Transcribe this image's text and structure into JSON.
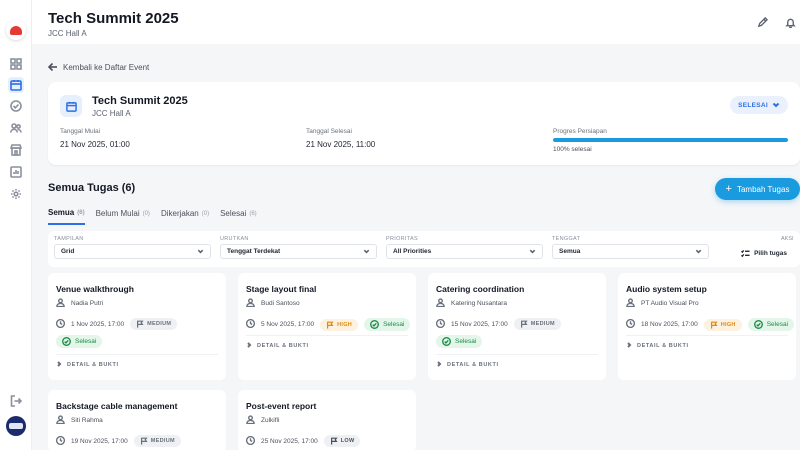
{
  "header": {
    "title": "Tech Summit 2025",
    "subtitle": "JCC Hall A"
  },
  "back_link": "Kembali ke Daftar Event",
  "event": {
    "title": "Tech Summit 2025",
    "location": "JCC Hall A",
    "status": "SELESAI",
    "start_label": "Tanggal Mulai",
    "start_value": "21 Nov 2025, 01:00",
    "end_label": "Tanggal Selesai",
    "end_value": "21 Nov 2025, 11:00",
    "progress_label": "Progres Persiapan",
    "progress_text": "100% selesai",
    "progress_value": 100
  },
  "section": {
    "title": "Semua Tugas (6)",
    "add_label": "Tambah Tugas"
  },
  "tabs": [
    {
      "label": "Semua",
      "count": "(6)"
    },
    {
      "label": "Belum Mulai",
      "count": "(0)"
    },
    {
      "label": "Dikerjakan",
      "count": "(0)"
    },
    {
      "label": "Selesai",
      "count": "(6)"
    }
  ],
  "filters": {
    "view": {
      "label": "TAMPILAN",
      "value": "Grid"
    },
    "sort": {
      "label": "URUTKAN",
      "value": "Tenggat Terdekat"
    },
    "priority": {
      "label": "PRIORITAS",
      "value": "All Priorities"
    },
    "deadline": {
      "label": "TENGGAT",
      "value": "Semua"
    },
    "action_label": "AKSI",
    "select_label": "Pilih tugas"
  },
  "detail_label": "DETAIL & BUKTI",
  "done_label": "Selesai",
  "tasks": [
    {
      "title": "Venue walkthrough",
      "assignee": "Nadia Putri",
      "date": "1 Nov 2025, 17:00",
      "priority": "MEDIUM"
    },
    {
      "title": "Stage layout final",
      "assignee": "Budi Santoso",
      "date": "5 Nov 2025, 17:00",
      "priority": "HIGH"
    },
    {
      "title": "Catering coordination",
      "assignee": "Katering Nusantara",
      "date": "15 Nov 2025, 17:00",
      "priority": "MEDIUM"
    },
    {
      "title": "Audio system setup",
      "assignee": "PT Audio Visual Pro",
      "date": "18 Nov 2025, 17:00",
      "priority": "HIGH"
    },
    {
      "title": "Backstage cable management",
      "assignee": "Siti Rahma",
      "date": "19 Nov 2025, 17:00",
      "priority": "MEDIUM"
    },
    {
      "title": "Post-event report",
      "assignee": "Zulkifli",
      "date": "25 Nov 2025, 17:00",
      "priority": "LOW"
    }
  ]
}
